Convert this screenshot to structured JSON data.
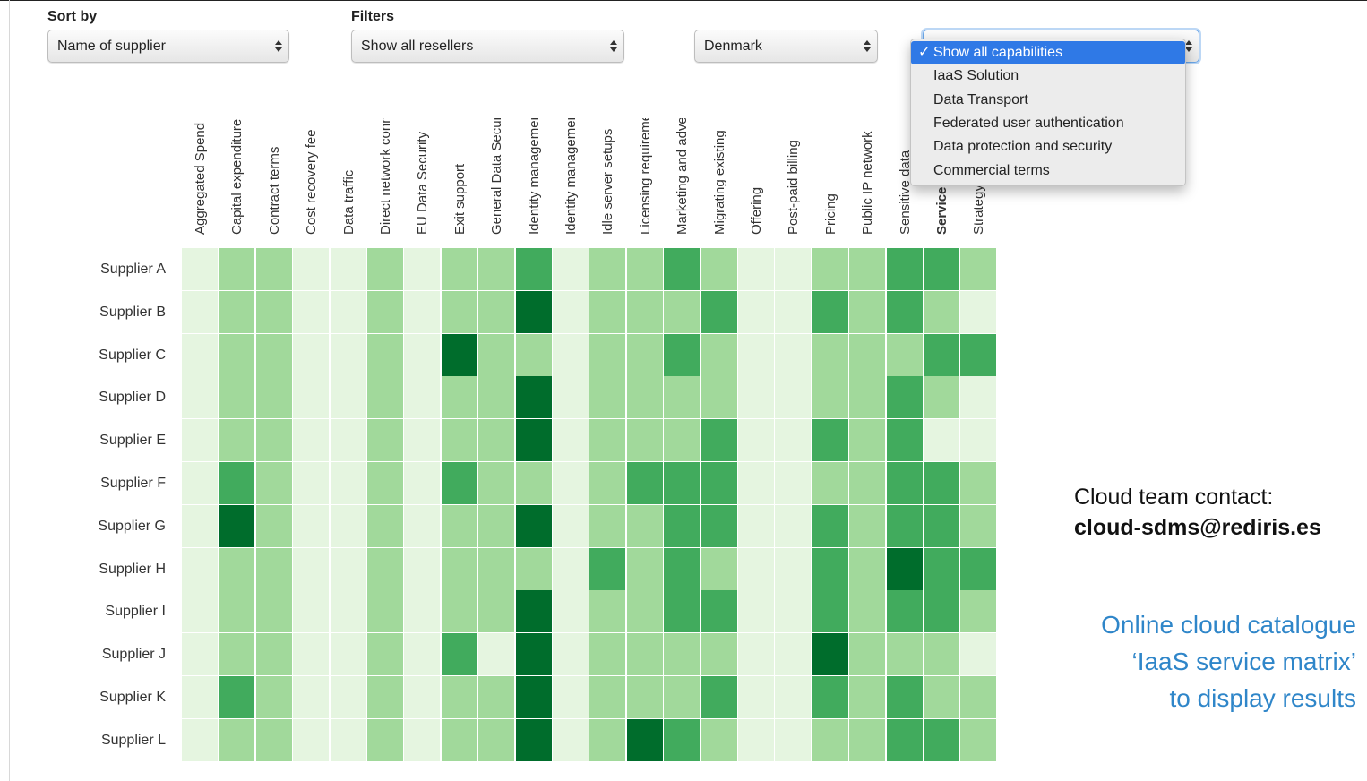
{
  "controls": {
    "sort_label": "Sort by",
    "filters_label": "Filters",
    "sort_value": "Name of supplier",
    "reseller_value": "Show all resellers",
    "country_value": "Denmark"
  },
  "capability_menu": {
    "check_glyph": "✓",
    "items": [
      "Show all capabilities",
      "IaaS Solution",
      "Data Transport",
      "Federated user authentication",
      "Data protection and security",
      "Commercial terms"
    ],
    "selected_index": 0
  },
  "matrix": {
    "columns": [
      "Aggregated Spend",
      "Capital expenditure",
      "Contract terms",
      "Cost recovery fee",
      "Data traffic",
      "Direct network connection",
      "EU Data Security",
      "Exit support",
      "General Data Security",
      "Identity management",
      "Identity management",
      "Idle server setups",
      "Licensing requirements",
      "Marketing and advertising",
      "Migrating existing",
      "Offering",
      "Post-paid billing",
      "Pricing",
      "Public IP network",
      "Sensitive data",
      "Service",
      "Strategy"
    ],
    "bold_column_index": 20,
    "rows": [
      "Supplier A",
      "Supplier B",
      "Supplier C",
      "Supplier D",
      "Supplier E",
      "Supplier F",
      "Supplier G",
      "Supplier H",
      "Supplier I",
      "Supplier J",
      "Supplier K",
      "Supplier L"
    ],
    "levels": [
      [
        0,
        1,
        1,
        0,
        0,
        1,
        0,
        1,
        1,
        2,
        0,
        1,
        1,
        2,
        1,
        0,
        0,
        1,
        1,
        2,
        2,
        1
      ],
      [
        0,
        1,
        1,
        0,
        0,
        1,
        0,
        1,
        1,
        3,
        0,
        1,
        1,
        1,
        2,
        0,
        0,
        2,
        1,
        2,
        1,
        0
      ],
      [
        0,
        1,
        1,
        0,
        0,
        1,
        0,
        3,
        1,
        1,
        0,
        1,
        1,
        2,
        1,
        0,
        0,
        1,
        1,
        1,
        2,
        2
      ],
      [
        0,
        1,
        1,
        0,
        0,
        1,
        0,
        1,
        1,
        3,
        0,
        1,
        1,
        1,
        1,
        0,
        0,
        1,
        1,
        2,
        1,
        0
      ],
      [
        0,
        1,
        1,
        0,
        0,
        1,
        0,
        1,
        1,
        3,
        0,
        1,
        1,
        1,
        2,
        0,
        0,
        2,
        1,
        2,
        0,
        0
      ],
      [
        0,
        2,
        1,
        0,
        0,
        1,
        0,
        2,
        1,
        1,
        0,
        1,
        2,
        2,
        2,
        0,
        0,
        1,
        1,
        2,
        2,
        1
      ],
      [
        0,
        3,
        1,
        0,
        0,
        1,
        0,
        1,
        1,
        3,
        0,
        1,
        1,
        2,
        2,
        0,
        0,
        2,
        1,
        2,
        2,
        1
      ],
      [
        0,
        1,
        1,
        0,
        0,
        1,
        0,
        1,
        1,
        1,
        0,
        2,
        1,
        2,
        1,
        0,
        0,
        2,
        1,
        3,
        2,
        2
      ],
      [
        0,
        1,
        1,
        0,
        0,
        1,
        0,
        1,
        1,
        3,
        0,
        1,
        1,
        2,
        2,
        0,
        0,
        2,
        1,
        2,
        2,
        1
      ],
      [
        0,
        1,
        1,
        0,
        0,
        1,
        0,
        2,
        0,
        3,
        0,
        1,
        1,
        1,
        1,
        0,
        0,
        3,
        1,
        1,
        1,
        0
      ],
      [
        0,
        2,
        1,
        0,
        0,
        1,
        0,
        1,
        1,
        3,
        0,
        1,
        1,
        1,
        2,
        0,
        0,
        2,
        1,
        2,
        1,
        1
      ],
      [
        0,
        1,
        1,
        0,
        0,
        1,
        0,
        1,
        1,
        3,
        0,
        1,
        3,
        2,
        1,
        0,
        0,
        1,
        1,
        2,
        2,
        1
      ]
    ],
    "level_colors": [
      "#e5f5e0",
      "#a1d99b",
      "#41ab5d",
      "#006d2c"
    ]
  },
  "contact": {
    "label": "Cloud team contact:",
    "email": "cloud-sdms@rediris.es"
  },
  "catalogue": {
    "line1": "Online cloud catalogue",
    "line2": "‘IaaS service matrix’",
    "line3": "to display results"
  }
}
